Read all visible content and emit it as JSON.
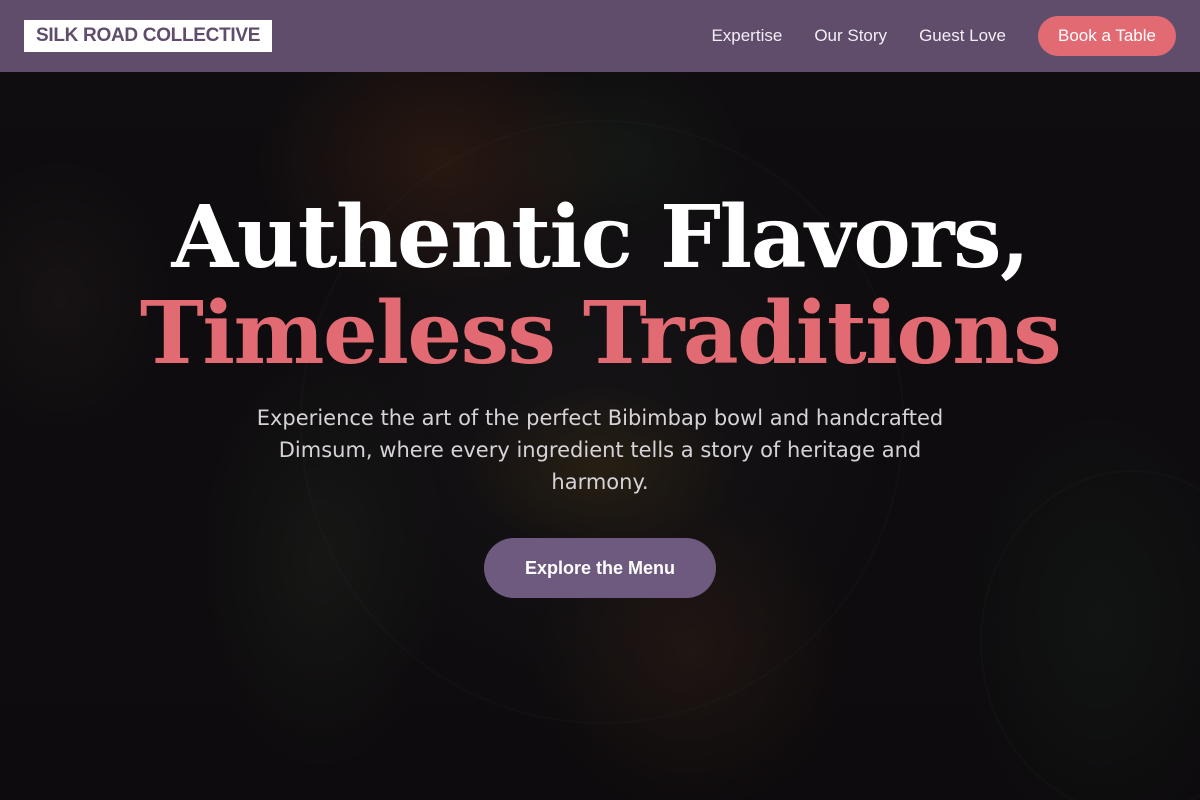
{
  "header": {
    "brand": "SILK ROAD COLLECTIVE",
    "nav": [
      {
        "label": "Expertise"
      },
      {
        "label": "Our Story"
      },
      {
        "label": "Guest Love"
      }
    ],
    "book_button": "Book a Table"
  },
  "hero": {
    "headline_line1": "Authentic Flavors,",
    "headline_line2": "Timeless Traditions",
    "description": "Experience the art of the perfect Bibimbap bowl and handcrafted Dimsum, where every ingredient tells a story of heritage and harmony.",
    "cta_label": "Explore the Menu"
  },
  "colors": {
    "nav_background": "#5f4d6b",
    "accent": "#e26a72",
    "cta_background": "#6e5a7e",
    "brand_text": "#5f4d6b"
  }
}
